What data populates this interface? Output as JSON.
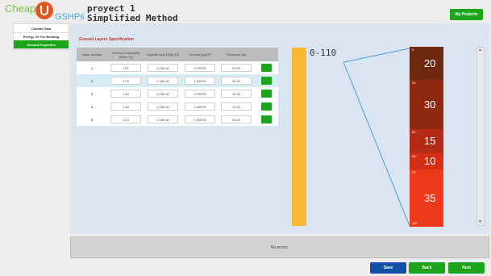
{
  "header": {
    "logo_cheap": "Cheap",
    "logo_gshps": "GSHPs",
    "project_name": "proyect 1",
    "method": "Simplified Method",
    "my_projects": "My Projects"
  },
  "sidebar": {
    "items": [
      {
        "label": "Climate Data",
        "active": false
      },
      {
        "label": "Energy Of The Building",
        "active": false
      },
      {
        "label": "Ground Properties",
        "active": true
      }
    ]
  },
  "section_title": "Ground Layers Specification",
  "table": {
    "headers": [
      "Layer number",
      "Termal Conductivity [W/(m K)]",
      "Specific heat [J/(kg K)]",
      "Density [kg/m³]",
      "Thickness [m]"
    ],
    "rows": [
      {
        "layer": "1",
        "conductivity": "1.57",
        "specific_heat": "1,000.00",
        "density": "2,000.00",
        "thickness": "20.00"
      },
      {
        "layer": "2",
        "conductivity": "1.70",
        "specific_heat": "2,300.00",
        "density": "1,900.00",
        "thickness": "30.00"
      },
      {
        "layer": "3",
        "conductivity": "1.80",
        "specific_heat": "1,000.00",
        "density": "2,000.00",
        "thickness": "15.00"
      },
      {
        "layer": "4",
        "conductivity": "1.40",
        "specific_heat": "1,000.00",
        "density": "1,000.00",
        "thickness": "10.00"
      },
      {
        "layer": "5",
        "conductivity": "3.20",
        "specific_heat": "2,500.00",
        "density": "2,600.00",
        "thickness": "35.00"
      }
    ]
  },
  "depth_range": "0-110",
  "layers_visual": [
    {
      "top": "0",
      "thickness": "20",
      "color": "#6e2a10"
    },
    {
      "top": "20",
      "thickness": "30",
      "color": "#8e2a12"
    },
    {
      "top": "50",
      "thickness": "15",
      "color": "#b32b14"
    },
    {
      "top": "65",
      "thickness": "10",
      "color": "#d42f17"
    },
    {
      "top": "75",
      "thickness": "35",
      "color": "#ee3a1c"
    }
  ],
  "bottom_label": "110",
  "status": "No errors.",
  "buttons": {
    "save": "Save",
    "back": "Back",
    "next": "Next"
  },
  "colors": {
    "green": "#1ca41c",
    "blue": "#1250a5",
    "depth_bar": "#fbb833",
    "panel": "#dbe5f1"
  }
}
